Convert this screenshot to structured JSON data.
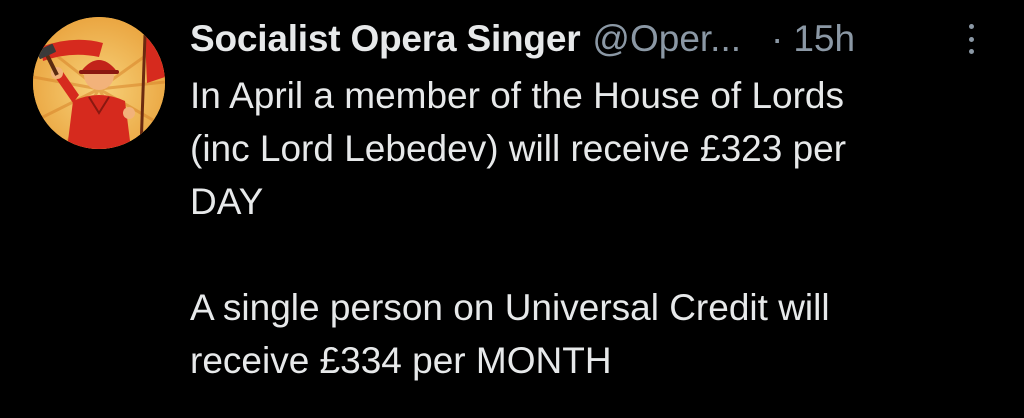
{
  "tweet": {
    "display_name": "Socialist Opera Singer",
    "handle": "@Oper...",
    "separator": "·",
    "time": "15h",
    "paragraphs": [
      "In April a member of the House of Lords\n(inc Lord Lebedev) will receive £323 per\nDAY",
      "A single person on Universal Credit will\nreceive £334 per MONTH"
    ],
    "avatar_icon": "socialist-worker-illustration",
    "more_icon": "vertical-ellipsis-icon"
  },
  "colors": {
    "background": "#000000",
    "text_primary": "#e7e9ea",
    "text_secondary": "#8b98a5",
    "avatar_bg": "#f0b04a",
    "avatar_red": "#d62a1e"
  }
}
